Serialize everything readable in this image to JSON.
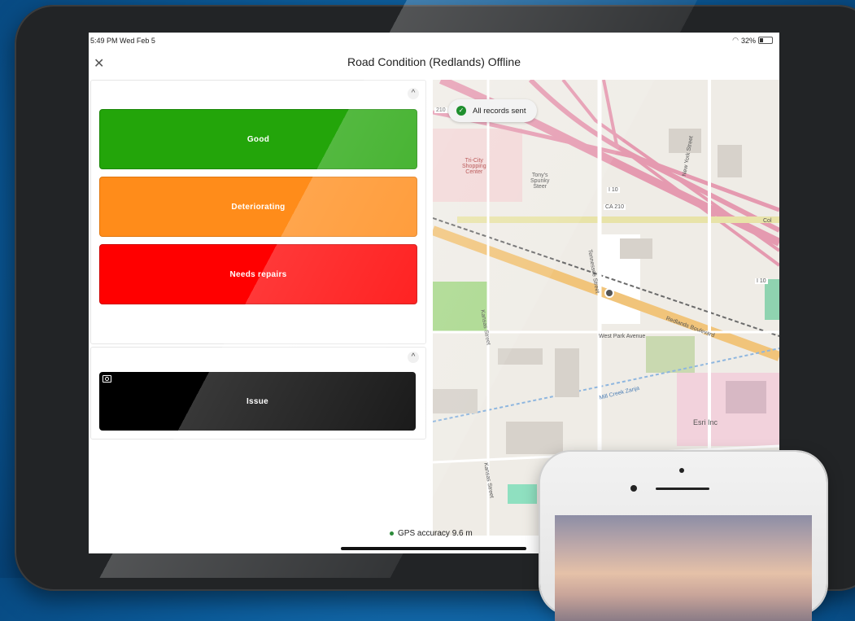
{
  "status_bar": {
    "time": "5:49 PM  Wed Feb 5",
    "battery": "32%"
  },
  "header": {
    "close_label": "✕",
    "title": "Road Condition (Redlands) Offline"
  },
  "form": {
    "collapse_label": "^",
    "condition_choices": [
      {
        "label": "Good",
        "color": "#23a50a"
      },
      {
        "label": "Deteriorating",
        "color": "#ff8c1a"
      },
      {
        "label": "Needs repairs",
        "color": "#ff0000"
      }
    ],
    "issue_label": "Issue"
  },
  "map": {
    "toast": "All records sent",
    "labels": {
      "shopping": "Tri-City\nShopping\nCenter",
      "tonys": "Tony's\nSpunky\nSteer",
      "i10_a": "I 10",
      "ca210": "CA 210",
      "i210": "210",
      "i10_b": "I 10",
      "ny_street": "New York Street",
      "tennessee": "Tennessee Street",
      "redlands_blvd": "Redlands Boulevard",
      "west_park": "West Park Avenue",
      "kansas_a": "Kansas Street",
      "kansas_b": "Kansas Street",
      "mill_creek": "Mill Creek Zanja",
      "esri": "Esri Inc",
      "col": "Col"
    }
  },
  "footer": {
    "gps": "GPS accuracy 9.6 m"
  }
}
